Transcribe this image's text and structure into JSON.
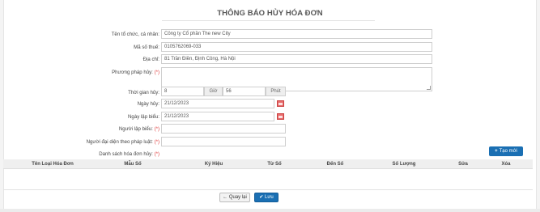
{
  "page_title": "THÔNG BÁO HỦY HÓA ĐƠN",
  "form": {
    "org_name": {
      "label": "Tên tổ chức, cá nhân:",
      "value": "Công ty Cổ phần The new City"
    },
    "tax_code": {
      "label": "Mã số thuế:",
      "value": "0105762069-033"
    },
    "address": {
      "label": "Địa chỉ:",
      "value": "81 Trần Điền, Định Công, Hà Nội"
    },
    "method": {
      "label": "Phương pháp hủy:",
      "required": "(*)",
      "value": ""
    },
    "cancel_time": {
      "label": "Thời gian hủy:",
      "hour": "8",
      "hour_unit": "Giờ",
      "minute": "56",
      "minute_unit": "Phút"
    },
    "cancel_date": {
      "label": "Ngày hủy:",
      "value": "21/12/2023"
    },
    "create_date": {
      "label": "Ngày lập biểu:",
      "value": "21/12/2023"
    },
    "creator": {
      "label": "Người lập biểu:",
      "required": "(*)",
      "value": ""
    },
    "legal_rep": {
      "label": "Người đại diện theo pháp luật:",
      "required": "(*)",
      "value": ""
    },
    "invoice_list": {
      "label": "Danh sách hóa đơn hủy:",
      "required": "(*)"
    }
  },
  "add_button": {
    "icon": "plus-icon",
    "label": "Tạo mới"
  },
  "table": {
    "columns": [
      "Tên Loại Hóa Đơn",
      "Mẫu Số",
      "Ký Hiệu",
      "Từ Số",
      "Đến Số",
      "Số Lượng",
      "Sửa",
      "Xóa"
    ],
    "rows": []
  },
  "actions": {
    "back": {
      "icon": "arrow-left-icon",
      "label": "Quay lại"
    },
    "save": {
      "icon": "check-icon",
      "label": "Lưu"
    }
  },
  "colors": {
    "primary": "#1a6fb3",
    "required": "#e04040",
    "calendar": "#e86a6a"
  }
}
